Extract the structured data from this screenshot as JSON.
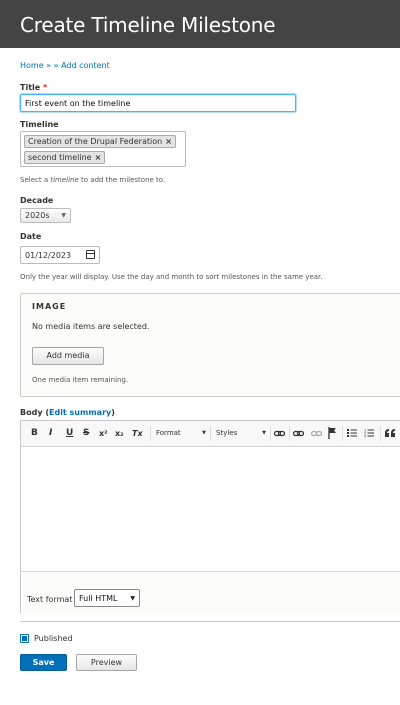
{
  "page": {
    "title": "Create Timeline Milestone"
  },
  "breadcrumb": {
    "home": "Home",
    "separator": "»",
    "separator2": "»",
    "add_content": "Add content"
  },
  "form": {
    "title_label": "Title",
    "required_marker": "*",
    "title_value": "First event on the timeline",
    "timeline_label": "Timeline",
    "timeline_tags": [
      {
        "label": "Creation of the Drupal Federation",
        "remove": "×"
      },
      {
        "label": "second timeline",
        "remove": "×"
      }
    ],
    "timeline_help_pre": "Select a",
    "timeline_help_em": "timeline",
    "timeline_help_post": "to add the milestone to.",
    "decade_label": "Decade",
    "decade_value": "2020s",
    "date_label": "Date",
    "date_value": "01/12/2023",
    "date_help": "Only the year will display. Use the day and month to sort milestones in the same year.",
    "image": {
      "legend": "IMAGE",
      "no_media": "No media items are selected.",
      "add_media": "Add media",
      "remaining": "One media item remaining."
    },
    "body_label": "Body",
    "edit_summary": "Edit summary",
    "toolbar": {
      "bold": "B",
      "italic": "I",
      "underline": "U",
      "strike": "S",
      "superscript": "x²",
      "subscript": "x₂",
      "remove_format": "Tx",
      "format_combo": "Format",
      "styles_combo": "Styles"
    },
    "text_format_label": "Text format",
    "text_format_value": "Full HTML",
    "published_label": "Published",
    "save_label": "Save",
    "preview_label": "Preview"
  },
  "colors": {
    "header_bg": "#444444",
    "link": "#0071b8",
    "primary_button": "#0071b8",
    "required": "#e32700"
  }
}
